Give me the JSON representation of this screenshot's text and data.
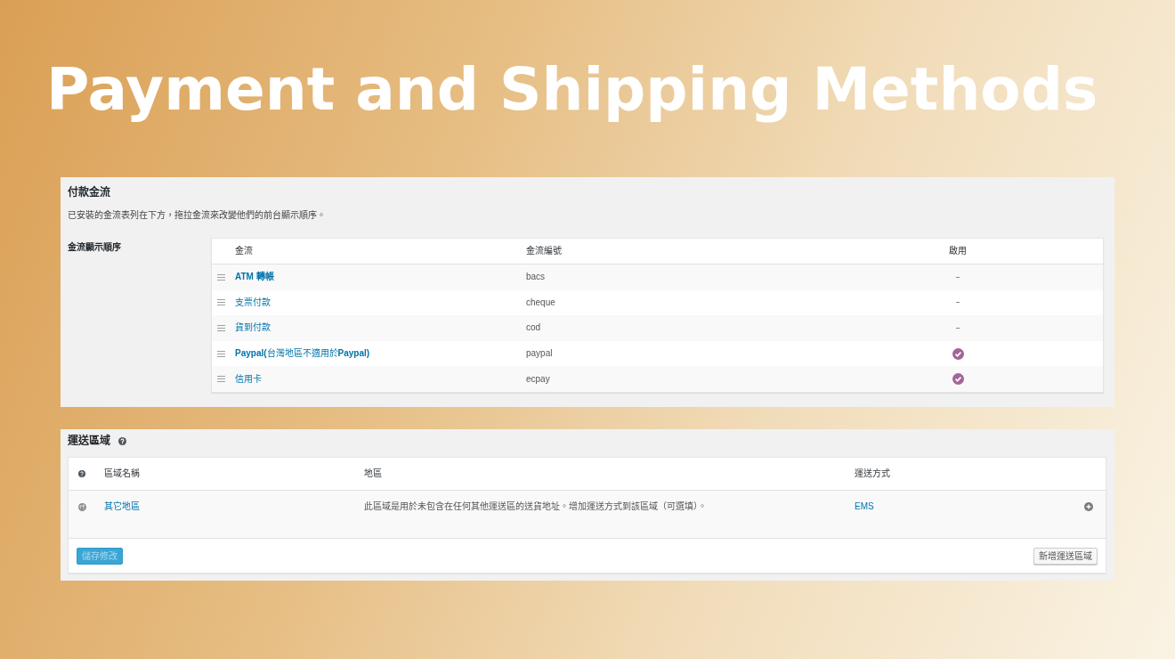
{
  "title": "Payment and Shipping Methods",
  "payment_panel": {
    "heading": "付款金流",
    "description": "已安裝的金流表列在下方，拖拉金流來改變他們的前台顯示順序。",
    "setting_label": "金流顯示順序",
    "table": {
      "columns": [
        "金流",
        "金流編號",
        "啟用"
      ],
      "rows": [
        {
          "name": "ATM 轉帳",
          "bold": true,
          "id": "bacs",
          "enabled": false
        },
        {
          "name": "支票付款",
          "bold": false,
          "id": "cheque",
          "enabled": false
        },
        {
          "name": "貨到付款",
          "bold": false,
          "id": "cod",
          "enabled": false
        },
        {
          "name": "**Paypal(**台灣地區不適用於**Paypal)**",
          "bold": false,
          "id": "paypal",
          "enabled": true
        },
        {
          "name": "信用卡",
          "bold": false,
          "id": "ecpay",
          "enabled": true
        }
      ]
    }
  },
  "shipping_panel": {
    "heading": "運送區域",
    "table": {
      "columns": [
        "區域名稱",
        "地區",
        "運送方式"
      ],
      "rows": [
        {
          "name": "其它地區",
          "region": "此區域是用於未包含在任何其他運送區的送貨地址。增加運送方式到該區域（可選填）。",
          "methods": "EMS"
        }
      ]
    },
    "buttons": [
      {
        "label": "儲存修改",
        "kind": "primary",
        "disabled": true
      },
      {
        "label": "新增運送區域",
        "kind": "secondary",
        "disabled": false
      }
    ]
  }
}
